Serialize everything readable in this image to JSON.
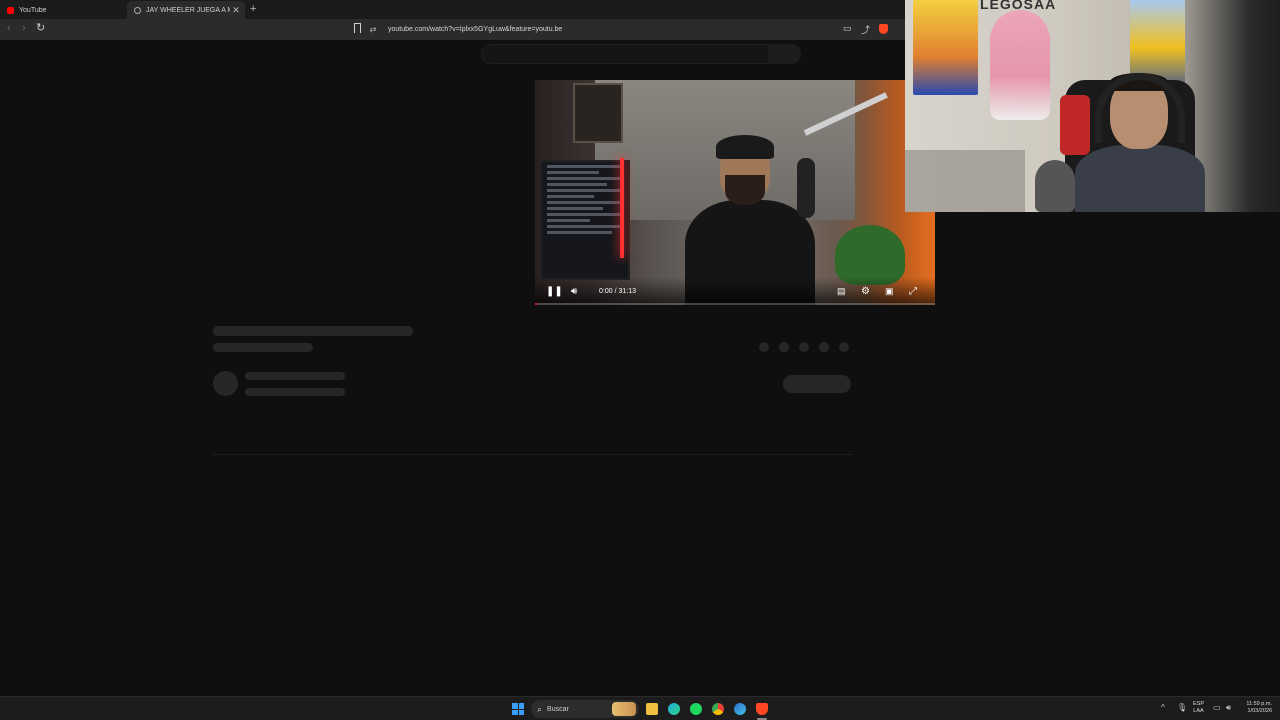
{
  "browser": {
    "tabs": [
      {
        "label": "YouTube",
        "icon": "youtube-icon",
        "active": false
      },
      {
        "label": "JAY WHEELER JUEGA A MY VOI",
        "icon": "globe-icon",
        "active": true
      }
    ],
    "new_tab_label": "+",
    "url": "youtube.com/watch?v=Iplxx5GYgLuw&feature=youtu.be",
    "brand_color": "#ff4724"
  },
  "player": {
    "time": "0:00 / 31:13",
    "progress": 0.0,
    "state": "playing",
    "accent": "#ff0000"
  },
  "webcam": {
    "logo_text": "LEGOSAA"
  },
  "taskbar": {
    "search_label": "Buscar",
    "lang_line1": "ESP",
    "lang_line2": "LAA",
    "time": "11:59 p.m.",
    "date": "1/03/2026",
    "pinned": [
      "windows-start",
      "search",
      "file-explorer",
      "edge",
      "spotify",
      "chrome",
      "edge-alt",
      "brave"
    ]
  }
}
